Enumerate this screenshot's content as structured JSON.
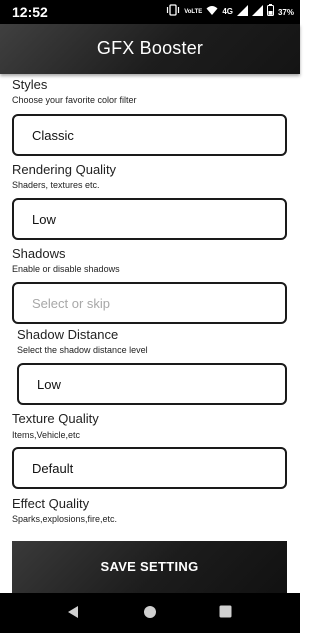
{
  "status_bar": {
    "time": "12:52",
    "volte_label": "VoLTE",
    "network_label": "4G",
    "battery_percent": "37%",
    "icons": [
      "vibrate-icon",
      "hd-icon",
      "wifi-icon",
      "signal-icon",
      "battery-icon"
    ]
  },
  "app_bar": {
    "title": "GFX Booster"
  },
  "sections": [
    {
      "heading": "Styles",
      "subtitle": "Choose your favorite color filter",
      "value": "Classic",
      "placeholder": ""
    },
    {
      "heading": "Rendering Quality",
      "subtitle": "Shaders, textures etc.",
      "value": "Low",
      "placeholder": ""
    },
    {
      "heading": "Shadows",
      "subtitle": "Enable or disable shadows",
      "value": "",
      "placeholder": "Select or skip"
    },
    {
      "heading": "Shadow Distance",
      "subtitle": "Select the shadow distance level",
      "value": "Low",
      "placeholder": ""
    },
    {
      "heading": "Texture Quality",
      "subtitle": "Items,Vehicle,etc",
      "value": "Default",
      "placeholder": ""
    },
    {
      "heading": "Effect Quality",
      "subtitle": "Sparks,explosions,fire,etc."
    }
  ],
  "save_button": {
    "label": "SAVE SETTING"
  },
  "nav_bar": {
    "icons": [
      "back-icon",
      "home-icon",
      "recents-icon"
    ]
  },
  "colors": {
    "app_bar": "#1d1d1d",
    "field_border": "#1a1a1a",
    "placeholder_text": "#a8a8a8",
    "button": "#1c1c1c"
  }
}
